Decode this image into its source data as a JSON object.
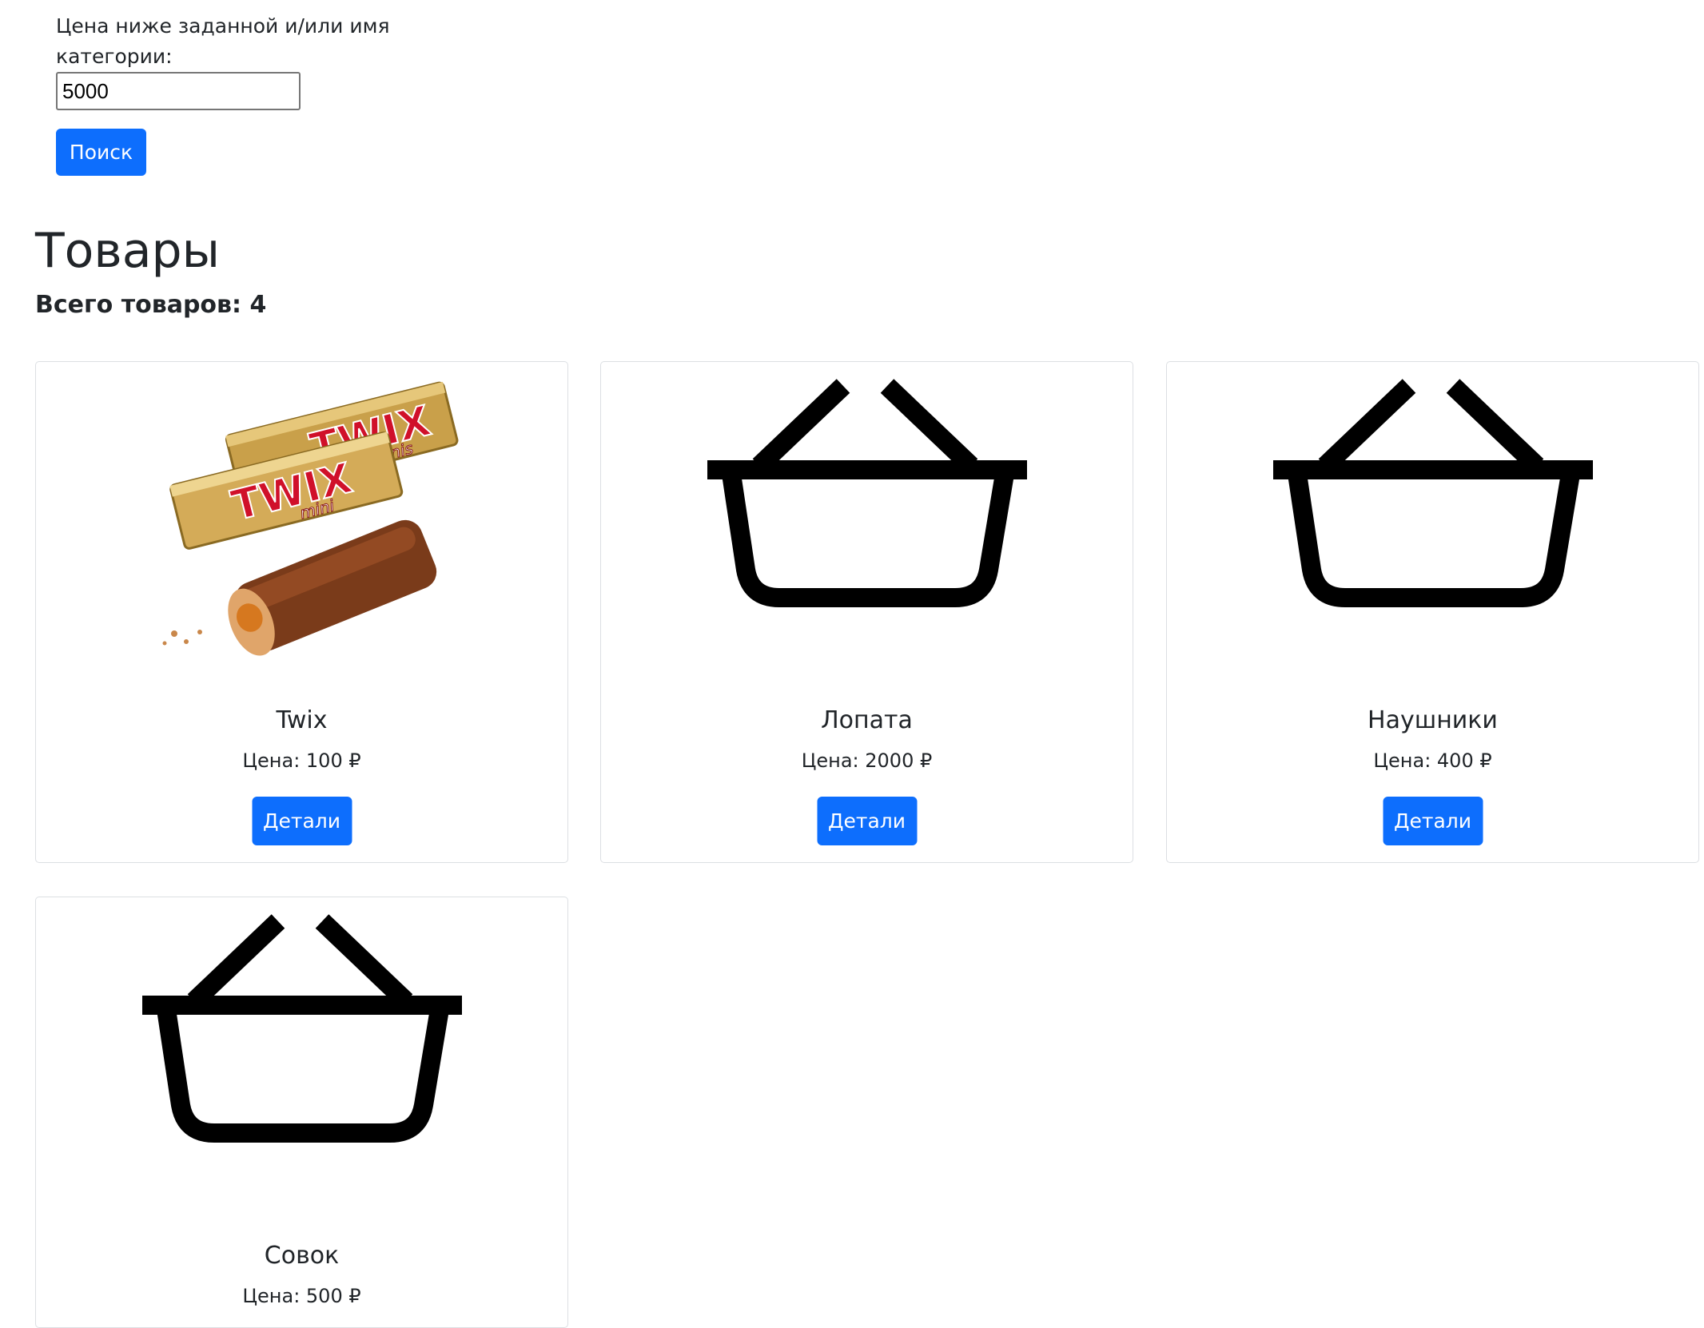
{
  "search": {
    "label": "Цена ниже заданной и/или имя категории:",
    "value": "5000",
    "button_label": "Поиск"
  },
  "heading": {
    "title": "Товары",
    "total": "Всего товаров: 4"
  },
  "products": [
    {
      "name": "Twix",
      "price": "Цена: 100 ₽",
      "details_label": "Детали",
      "image": "twix-product-photo"
    },
    {
      "name": "Лопата",
      "price": "Цена: 2000 ₽",
      "details_label": "Детали",
      "image": "basket-icon"
    },
    {
      "name": "Наушники",
      "price": "Цена: 400 ₽",
      "details_label": "Детали",
      "image": "basket-icon"
    },
    {
      "name": "Совок",
      "price": "Цена: 500 ₽",
      "details_label": "Детали",
      "image": "basket-icon"
    }
  ],
  "colors": {
    "primary": "#0d6efd",
    "text": "#212529",
    "card_border": "#dcdfe3"
  }
}
